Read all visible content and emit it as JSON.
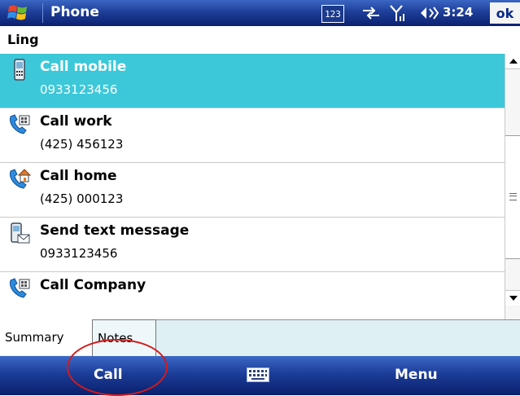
{
  "titlebar": {
    "app_title": "Phone",
    "status_icons": [
      "input-123-icon",
      "sync-arrows-icon",
      "signal-strength-icon",
      "speaker-volume-icon"
    ],
    "input_mode": "123",
    "time": "3:24",
    "ok_label": "ok"
  },
  "contact": {
    "name": "Ling"
  },
  "items": [
    {
      "label": "Call mobile",
      "value": "0933123456",
      "icon": "mobile-phone-icon",
      "selected": true
    },
    {
      "label": "Call work",
      "value": "(425) 456123",
      "icon": "work-phone-icon",
      "selected": false
    },
    {
      "label": "Call home",
      "value": "(425) 000123",
      "icon": "home-phone-icon",
      "selected": false
    },
    {
      "label": "Send text message",
      "value": "0933123456",
      "icon": "sms-icon",
      "selected": false
    },
    {
      "label": "Call Company",
      "value": "",
      "icon": "company-phone-icon",
      "selected": false
    }
  ],
  "tabs": [
    {
      "label": "Summary",
      "active": true
    },
    {
      "label": "Notes",
      "active": false
    }
  ],
  "softkeys": {
    "left": "Call",
    "right": "Menu",
    "center_icon": "keyboard-icon"
  },
  "colors": {
    "title_bar": "#1e3f99",
    "selected_row": "#3cc8d9",
    "annotation": "#d61a1a"
  }
}
